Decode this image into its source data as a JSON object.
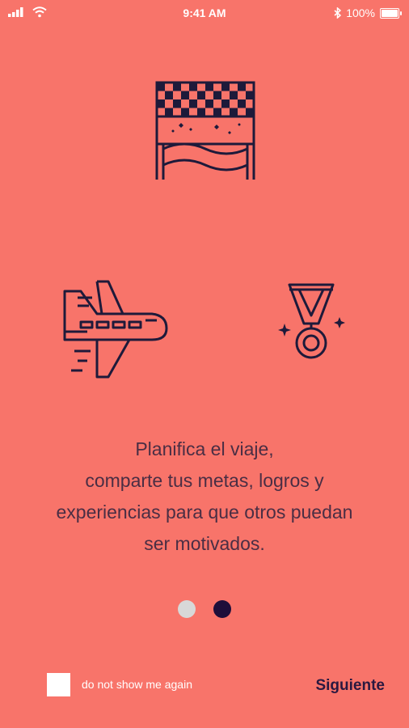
{
  "status_bar": {
    "time": "9:41 AM",
    "battery": "100%",
    "battery_level_percent": 100,
    "icons": [
      "signal-icon",
      "wifi-icon",
      "bluetooth-icon",
      "battery-icon"
    ]
  },
  "illustrations": [
    "finish-line-icon",
    "airplane-icon",
    "medal-icon"
  ],
  "description": {
    "lines": [
      "Planifica el viaje,",
      "comparte tus metas, logros y",
      "experiencias para que otros puedan",
      "ser motivados."
    ]
  },
  "pager": {
    "page_count": 2,
    "current_page": 2
  },
  "footer": {
    "checkbox_label": "do not show me again",
    "checkbox_checked": false,
    "next_label": "Siguiente"
  },
  "colors": {
    "background": "#F8746A",
    "icon_stroke": "#1E1A3A",
    "dot_active": "#1E0E3A",
    "dot_inactive": "#D8D8D8",
    "text": "#4A2E44"
  }
}
